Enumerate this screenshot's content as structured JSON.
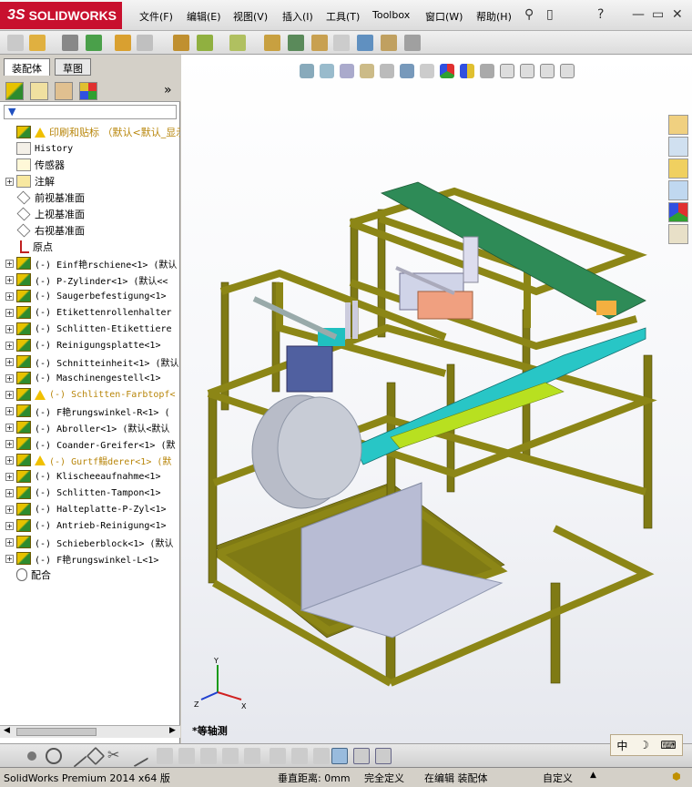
{
  "app": {
    "logo_text": "SOLIDWORKS",
    "logo_prefix": "3S"
  },
  "menu": [
    "文件(F)",
    "编辑(E)",
    "视图(V)",
    "插入(I)",
    "工具(T)",
    "Toolbox",
    "窗口(W)",
    "帮助(H)"
  ],
  "panel": {
    "tabs": [
      "装配体",
      "草图"
    ],
    "expand_glyph": "»"
  },
  "tree": [
    {
      "label": "印刷和贴标  （默认<默认_显示",
      "warn": true,
      "cn": true,
      "plus": false,
      "type": "asm"
    },
    {
      "label": "History",
      "plus": false,
      "type": "history"
    },
    {
      "label": "传感器",
      "plus": false,
      "cn": true,
      "type": "sensor"
    },
    {
      "label": "注解",
      "plus": true,
      "cn": true,
      "type": "annot"
    },
    {
      "label": "前视基准面",
      "plus": false,
      "cn": true,
      "type": "plane"
    },
    {
      "label": "上视基准面",
      "plus": false,
      "cn": true,
      "type": "plane"
    },
    {
      "label": "右视基准面",
      "plus": false,
      "cn": true,
      "type": "plane"
    },
    {
      "label": "原点",
      "plus": false,
      "cn": true,
      "type": "origin"
    },
    {
      "label": "(-) Einf艳rschiene<1> (默认",
      "plus": true,
      "type": "asm"
    },
    {
      "label": "(-) P-Zylinder<1> (默认<<",
      "plus": true,
      "type": "asm"
    },
    {
      "label": "(-) Saugerbefestigung<1>",
      "plus": true,
      "type": "asm"
    },
    {
      "label": "(-) Etikettenrollenhalter",
      "plus": true,
      "type": "asm"
    },
    {
      "label": "(-) Schlitten-Etikettiere",
      "plus": true,
      "type": "asm"
    },
    {
      "label": "(-) Reinigungsplatte<1>",
      "plus": true,
      "type": "asm"
    },
    {
      "label": "(-) Schnitteinheit<1> (默认",
      "plus": true,
      "type": "asm"
    },
    {
      "label": "(-) Maschinengestell<1>",
      "plus": true,
      "type": "asm"
    },
    {
      "label": "(-) Schlitten-Farbtopf<",
      "plus": true,
      "type": "asm",
      "warn": true
    },
    {
      "label": "(-) F艳rungswinkel-R<1> (",
      "plus": true,
      "type": "asm"
    },
    {
      "label": "(-) Abroller<1> (默认<默认",
      "plus": true,
      "type": "asm"
    },
    {
      "label": "(-) Coander-Greifer<1> (默",
      "plus": true,
      "type": "asm"
    },
    {
      "label": "(-) Gurtf鳎derer<1> (默",
      "plus": true,
      "type": "asm",
      "warn": true
    },
    {
      "label": "(-) Klischeeaufnahme<1>",
      "plus": true,
      "type": "asm"
    },
    {
      "label": "(-) Schlitten-Tampon<1>",
      "plus": true,
      "type": "asm"
    },
    {
      "label": "(-) Halteplatte-P-Zyl<1>",
      "plus": true,
      "type": "asm"
    },
    {
      "label": "(-) Antrieb-Reinigung<1>",
      "plus": true,
      "type": "asm"
    },
    {
      "label": "(-) Schieberblock<1> (默认",
      "plus": true,
      "type": "asm"
    },
    {
      "label": "(-) F艳rungswinkel-L<1>",
      "plus": true,
      "type": "asm"
    },
    {
      "label": "配合",
      "plus": false,
      "cn": true,
      "type": "mates"
    }
  ],
  "viewport": {
    "view_label": "*等轴测"
  },
  "triad": {
    "x": "X",
    "y": "Y",
    "z": "Z"
  },
  "ime": {
    "mode": "中"
  },
  "status": {
    "product": "SolidWorks Premium 2014 x64 版",
    "distance": "垂直距离: 0mm",
    "defined": "完全定义",
    "editing": "在编辑 装配体",
    "custom": "自定义",
    "arrow": "▲"
  }
}
